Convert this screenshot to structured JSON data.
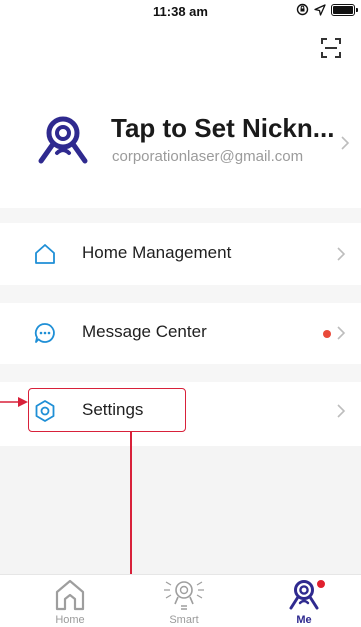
{
  "status_bar": {
    "time": "11:38 am"
  },
  "profile": {
    "nickname": "Tap to Set Nickn...",
    "email": "corporationlaser@gmail.com"
  },
  "menu": {
    "items": [
      {
        "label": "Home Management",
        "icon": "home-icon"
      },
      {
        "label": "Message Center",
        "icon": "message-icon",
        "has_unread_dot": true
      },
      {
        "label": "Settings",
        "icon": "settings-icon"
      }
    ]
  },
  "tabbar": {
    "tabs": [
      {
        "label": "Home",
        "icon": "home-tab-icon"
      },
      {
        "label": "Smart",
        "icon": "smart-tab-icon"
      },
      {
        "label": "Me",
        "icon": "me-tab-icon",
        "active": true,
        "badge": true
      }
    ]
  },
  "colors": {
    "accent": "#2f2a8f",
    "icon_blue": "#1f8fd6",
    "unread_dot": "#e94a3a",
    "annotation": "#d8213a"
  }
}
